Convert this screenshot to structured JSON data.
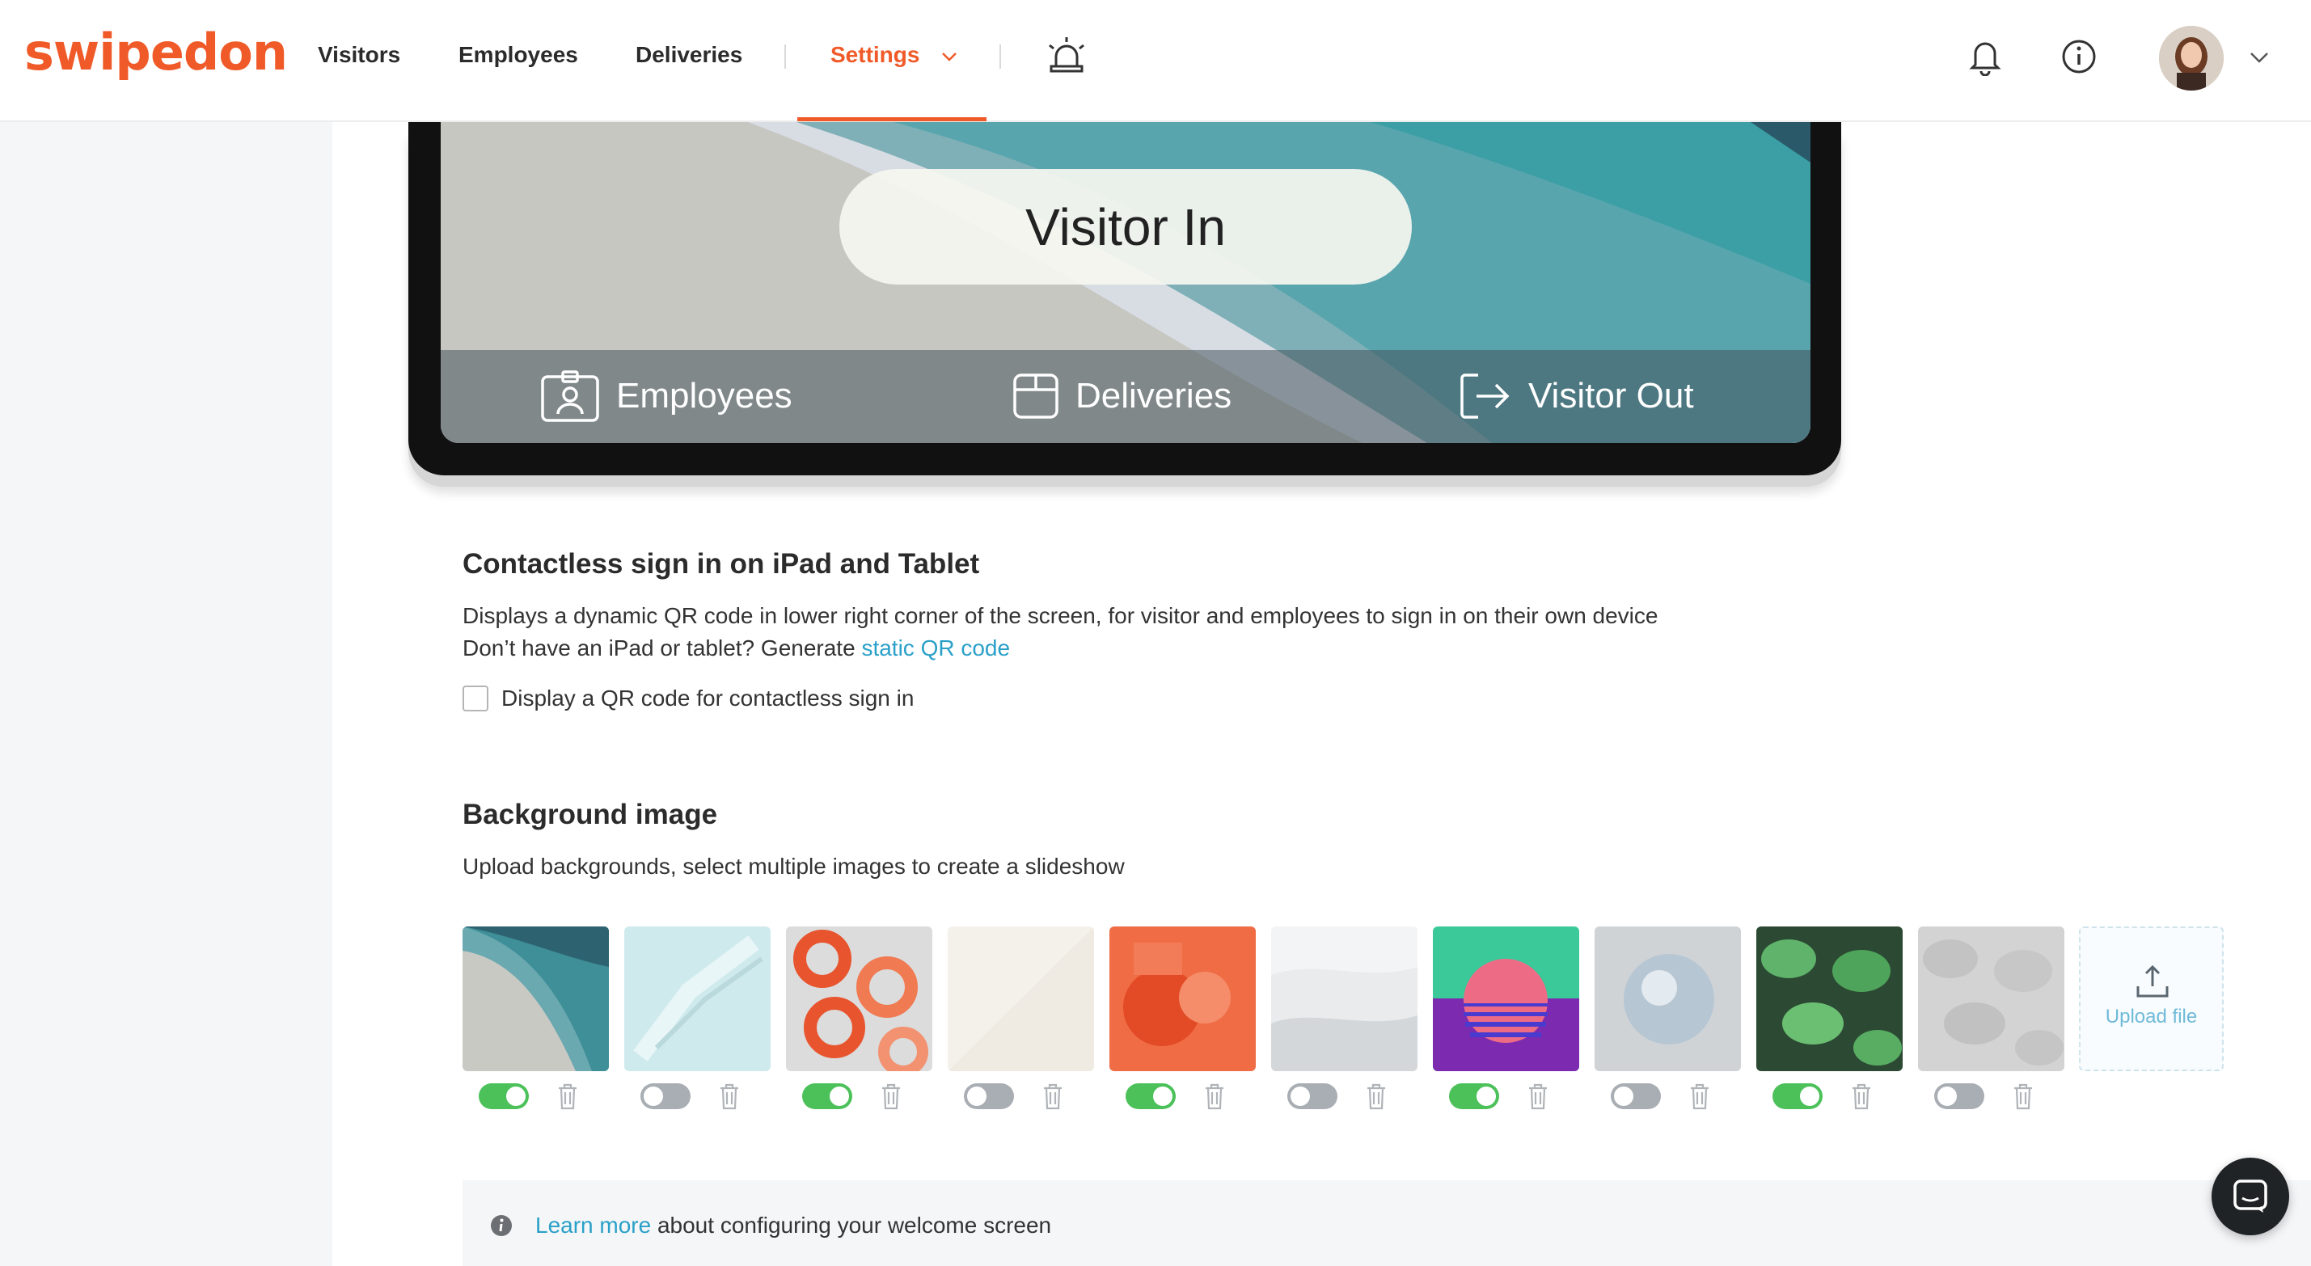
{
  "header": {
    "logo": "swipedon",
    "nav": {
      "visitors": "Visitors",
      "employees": "Employees",
      "deliveries": "Deliveries",
      "settings": "Settings"
    },
    "icons": [
      "alarm-icon",
      "bell-icon",
      "info-icon",
      "chevron-down-icon"
    ],
    "accent_color": "#f05a28"
  },
  "preview": {
    "visitor_in": "Visitor In",
    "bar": {
      "employees": "Employees",
      "deliveries": "Deliveries",
      "visitor_out": "Visitor Out"
    }
  },
  "contactless": {
    "title": "Contactless sign in on iPad and Tablet",
    "description": "Displays a dynamic QR code in lower right corner of the screen, for visitor and employees to sign in on their own device",
    "generate_prefix": "Don’t have an iPad or tablet? Generate ",
    "generate_link": "static QR code",
    "checkbox_label": "Display a QR code for contactless sign in",
    "checkbox_checked": false
  },
  "background": {
    "title": "Background image",
    "description": "Upload backgrounds, select multiple images to create a slideshow",
    "images": [
      {
        "name": "teal-waves",
        "enabled": true
      },
      {
        "name": "ice-crystal",
        "enabled": false
      },
      {
        "name": "orange-rings",
        "enabled": true
      },
      {
        "name": "cream-paper",
        "enabled": false
      },
      {
        "name": "orange-geometric",
        "enabled": true
      },
      {
        "name": "foggy-sky",
        "enabled": false
      },
      {
        "name": "retro-sunset",
        "enabled": true
      },
      {
        "name": "bubble",
        "enabled": false
      },
      {
        "name": "monstera-leaves",
        "enabled": true
      },
      {
        "name": "grey-leaves",
        "enabled": false
      }
    ],
    "upload_label": "Upload file"
  },
  "info": {
    "link": "Learn more",
    "text": " about configuring your welcome screen"
  }
}
